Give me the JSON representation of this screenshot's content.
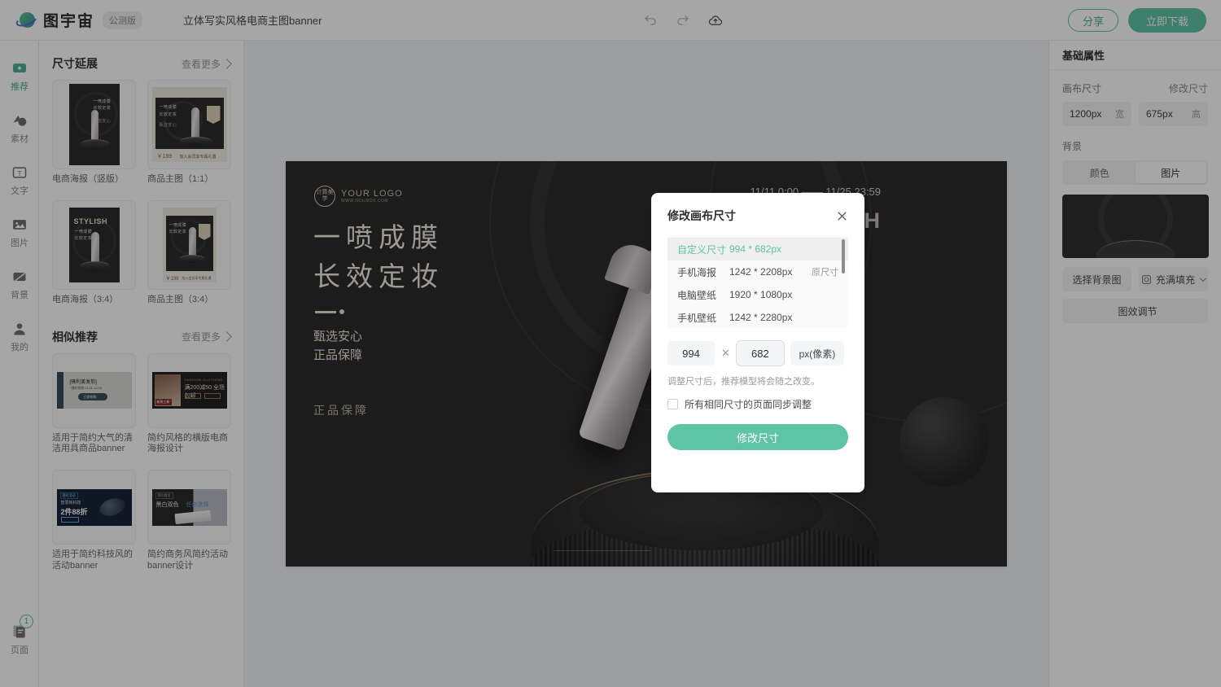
{
  "header": {
    "brand": "图宇宙",
    "beta_badge": "公测版",
    "doc_title": "立体写实风格电商主图banner",
    "undo_icon": "undo-icon",
    "redo_icon": "redo-icon",
    "upload_icon": "upload-cloud-icon",
    "share_label": "分享",
    "download_label": "立即下载",
    "accent_color": "#5fc4a5"
  },
  "rail": {
    "items": [
      {
        "label": "推荐",
        "icon": "recommend-icon",
        "active": true
      },
      {
        "label": "素材",
        "icon": "material-icon",
        "active": false
      },
      {
        "label": "文字",
        "icon": "text-icon",
        "active": false
      },
      {
        "label": "图片",
        "icon": "image-icon",
        "active": false
      },
      {
        "label": "背景",
        "icon": "background-icon",
        "active": false
      },
      {
        "label": "我的",
        "icon": "user-icon",
        "active": false
      }
    ],
    "pages": {
      "label": "页面",
      "icon": "pages-icon",
      "badge": "1"
    }
  },
  "panel": {
    "sections": [
      {
        "title": "尺寸延展",
        "more_label": "查看更多",
        "cards": [
          {
            "label": "电商海报（竖版）",
            "kind": "poster-vertical"
          },
          {
            "label": "商品主图（1:1）",
            "kind": "product-square"
          },
          {
            "label": "电商海报（3:4）",
            "kind": "poster-34"
          },
          {
            "label": "商品主图（3:4）",
            "kind": "product-34"
          }
        ]
      },
      {
        "title": "相似推荐",
        "more_label": "查看更多",
        "cards": [
          {
            "label": "适用于简约大气的清洁用具商品banner",
            "kind": "banner-clean"
          },
          {
            "label": "简约风格的横版电商海报设计",
            "kind": "banner-fashion"
          },
          {
            "label": "适用于简约科技风的活动banner",
            "kind": "banner-tech"
          },
          {
            "label": "简约商务风简约活动banner设计",
            "kind": "banner-keyboard"
          }
        ]
      }
    ]
  },
  "canvas": {
    "logo_main": "YOUR LOGO",
    "logo_sub": "WWW.NOLIBOX.COM",
    "logo_mark": "计算美学",
    "date_range": "11/11 0:00 —— 11/25 23:59",
    "stylish": "STYLISH",
    "headline_line1": "一喷成膜",
    "headline_line2": "长效定妆",
    "sub_line1": "甄选安心",
    "sub_line2": "正品保障",
    "footer_text": "正品保障",
    "cart_icon": "shopping-cart-icon"
  },
  "right": {
    "title": "基础属性",
    "canvas_size_label": "画布尺寸",
    "modify_size_label": "修改尺寸",
    "width_value": "1200px",
    "width_unit": "宽",
    "height_value": "675px",
    "height_unit": "高",
    "background_label": "背景",
    "tab_color": "颜色",
    "tab_image": "图片",
    "active_tab": "图片",
    "choose_bg_label": "选择背景图",
    "fill_mode_label": "充满填充",
    "fill_icon": "fill-frame-icon",
    "adjust_label": "图效调节",
    "adjust_icon": "image-effect-icon"
  },
  "modal": {
    "title": "修改画布尺寸",
    "close_icon": "close-icon",
    "presets": [
      {
        "name": "自定义尺寸",
        "value": "994 * 682px",
        "tag": "",
        "selected": true
      },
      {
        "name": "手机海报",
        "value": "1242 * 2208px",
        "tag": "原尺寸",
        "selected": false
      },
      {
        "name": "电脑壁纸",
        "value": "1920 * 1080px",
        "tag": "",
        "selected": false
      },
      {
        "name": "手机壁纸",
        "value": "1242 * 2280px",
        "tag": "",
        "selected": false
      }
    ],
    "width_input": "994",
    "times_symbol": "✕",
    "height_input": "682",
    "unit_label": "px(像素)",
    "hint": "调整尺寸后，推荐模型将会随之改变。",
    "checkbox_label": "所有相同尺寸的页面同步调整",
    "apply_label": "修改尺寸"
  }
}
